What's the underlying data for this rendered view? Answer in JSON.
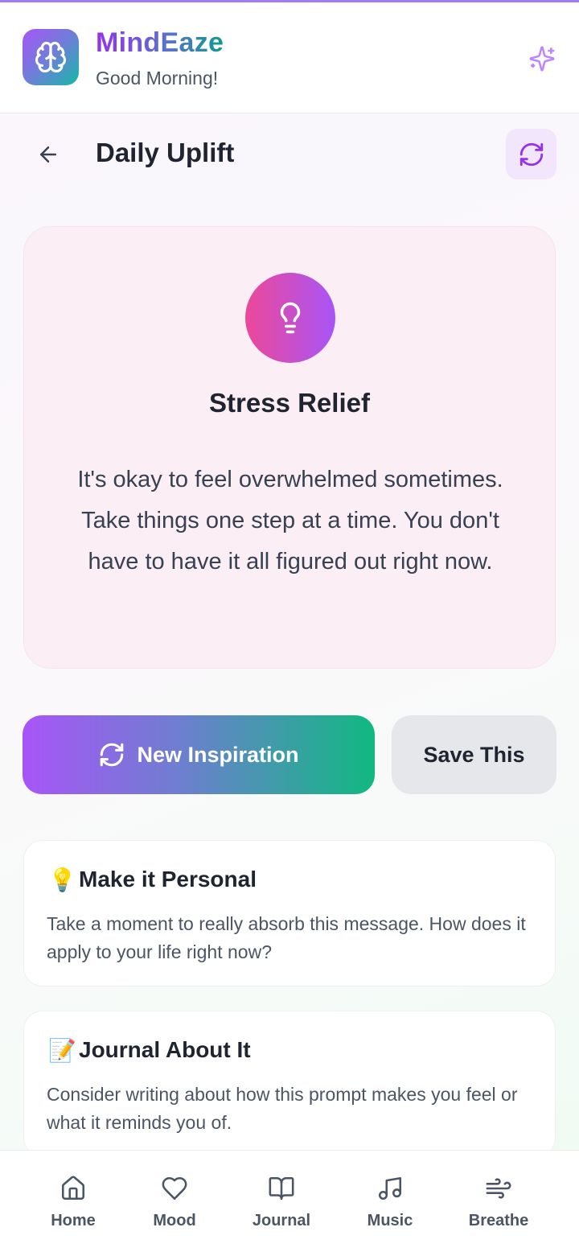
{
  "header": {
    "app_name": "MindEaze",
    "greeting": "Good Morning!",
    "logo_icon": "brain-icon",
    "action_icon": "sparkles-icon"
  },
  "page": {
    "title": "Daily Uplift",
    "back_icon": "arrow-left-icon",
    "refresh_icon": "refresh-icon"
  },
  "quote": {
    "icon": "lightbulb-icon",
    "category": "Stress Relief",
    "message": "It's okay to feel overwhelmed sometimes. Take things one step at a time. You don't have to have it all figured out right now."
  },
  "actions": {
    "new_label": "New Inspiration",
    "save_label": "Save This"
  },
  "tips": [
    {
      "emoji": "💡",
      "title": "Make it Personal",
      "text": "Take a moment to really absorb this message. How does it apply to your life right now?"
    },
    {
      "emoji": "📝",
      "title": "Journal About It",
      "text": "Consider writing about how this prompt makes you feel or what it reminds you of."
    }
  ],
  "nav": {
    "items": [
      {
        "label": "Home",
        "icon": "home-icon"
      },
      {
        "label": "Mood",
        "icon": "heart-icon"
      },
      {
        "label": "Journal",
        "icon": "book-icon"
      },
      {
        "label": "Music",
        "icon": "music-icon"
      },
      {
        "label": "Breathe",
        "icon": "wind-icon"
      }
    ]
  },
  "colors": {
    "brand_purple": "#a855f7",
    "brand_green": "#10b981",
    "card_pink": "#fbeff5",
    "refresh_bg": "#f2e6fd"
  }
}
